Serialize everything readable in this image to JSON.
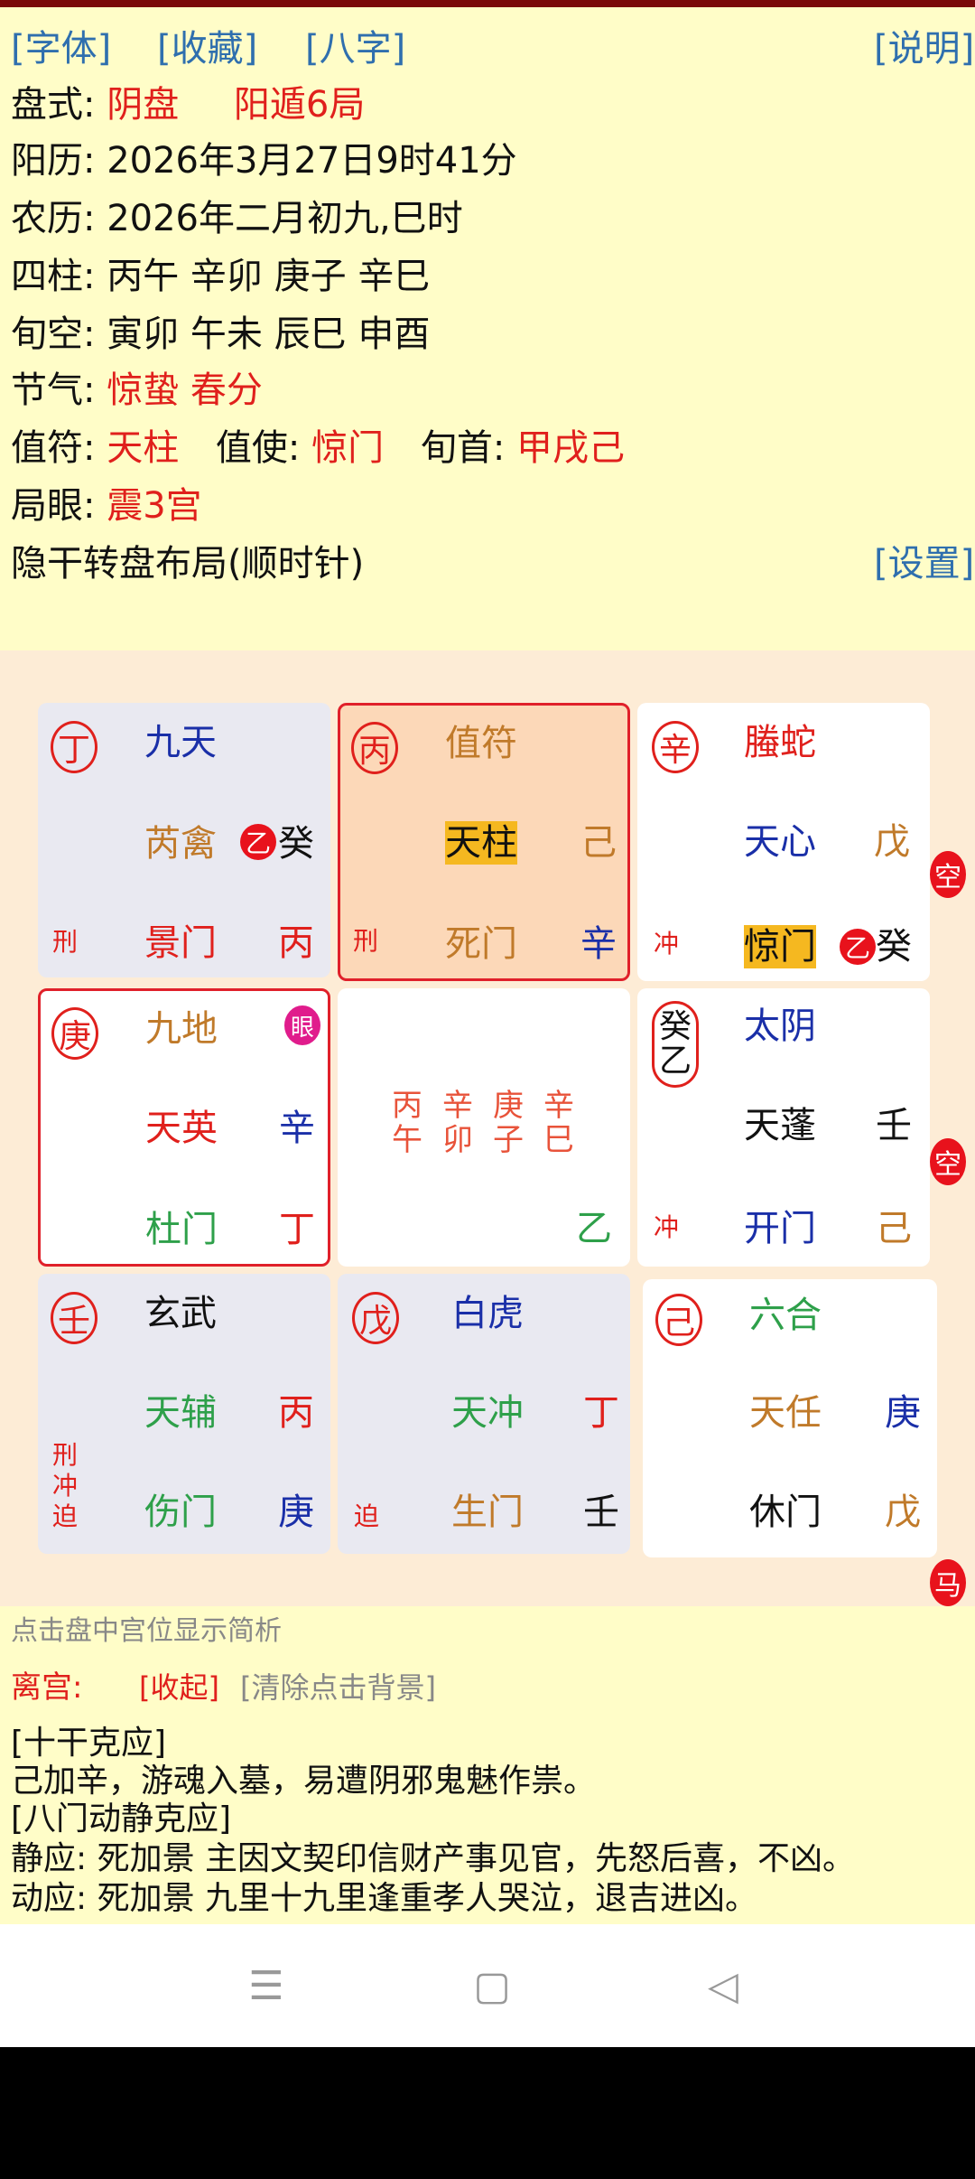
{
  "header": {
    "btn_font": "[字体]",
    "btn_fav": "[收藏]",
    "btn_bazi": "[八字]",
    "btn_help": "[说明]"
  },
  "info": {
    "panshi_label": "盘式:",
    "panshi_val1": "阴盘",
    "panshi_val2": "阳遁6局",
    "yangli": "阳历: 2026年3月27日9时41分",
    "nongli": "农历: 2026年二月初九,巳时",
    "sizhu": "四柱: 丙午  辛卯  庚子  辛巳",
    "xunkong": "旬空: 寅卯  午未  辰巳  申酉",
    "jieqi_label": "节气:",
    "jieqi_val": "惊蛰 春分",
    "zhifu_label": "值符:",
    "zhifu_val": "天柱",
    "zhishi_label": "值使:",
    "zhishi_val": "惊门",
    "xunshou_label": "旬首:",
    "xunshou_val": "甲戌己",
    "juyan_label": "局眼:",
    "juyan_val": "震3宫",
    "layout_text": "隐干转盘布局(顺时针)",
    "btn_settings": "[设置]"
  },
  "board": {
    "palaces": [
      {
        "id": "xun",
        "gan": "丁",
        "god": "九天",
        "star": "芮禽",
        "star_gan": "癸",
        "star_badge": "乙",
        "door": "景门",
        "door_gan": "丙",
        "tags": [
          "刑"
        ]
      },
      {
        "id": "li",
        "gan": "丙",
        "god": "值符",
        "star": "天柱",
        "star_gan": "己",
        "door": "死门",
        "door_gan": "辛",
        "tags": [
          "刑"
        ]
      },
      {
        "id": "kun",
        "gan": "辛",
        "god": "螣蛇",
        "star": "天心",
        "star_gan": "戊",
        "door": "惊门",
        "door_gan": "癸",
        "door_badge": "乙",
        "tags": [
          "冲"
        ]
      },
      {
        "id": "zhen",
        "gan": "庚",
        "god": "九地",
        "star": "天英",
        "star_gan": "辛",
        "door": "杜门",
        "door_gan": "丁",
        "eye": "眼"
      },
      {
        "id": "dui",
        "gan": "癸",
        "gan2": "乙",
        "god": "太阴",
        "star": "天蓬",
        "star_gan": "壬",
        "door": "开门",
        "door_gan": "己",
        "tags": [
          "冲"
        ]
      },
      {
        "id": "gen",
        "gan": "壬",
        "god": "玄武",
        "star": "天辅",
        "star_gan": "丙",
        "door": "伤门",
        "door_gan": "庚",
        "tags": [
          "刑",
          "冲",
          "迫"
        ]
      },
      {
        "id": "kan",
        "gan": "戊",
        "god": "白虎",
        "star": "天冲",
        "star_gan": "丁",
        "door": "生门",
        "door_gan": "壬",
        "tags": [
          "迫"
        ]
      },
      {
        "id": "qian",
        "gan": "己",
        "god": "六合",
        "star": "天任",
        "star_gan": "庚",
        "door": "休门",
        "door_gan": "戊"
      }
    ],
    "center": {
      "pillars": [
        [
          "丙",
          "午"
        ],
        [
          "辛",
          "卯"
        ],
        [
          "庚",
          "子"
        ],
        [
          "辛",
          "巳"
        ]
      ],
      "gan": "乙"
    },
    "side_kong1": "空",
    "side_kong2": "空",
    "side_ma": "马"
  },
  "bottom": {
    "hint": "点击盘中宫位显示简析",
    "palace_name": "离宫:",
    "btn_collapse": "[收起]",
    "btn_clear": "[清除点击背景]",
    "sec1_title": "[十干克应]",
    "sec1_text": "己加辛，游魂入墓，易遭阴邪鬼魅作祟。",
    "sec2_title": "[八门动静克应]",
    "sec2_line1": "静应: 死加景 主因文契印信财产事见官，先怒后喜，不凶。",
    "sec2_line2": "动应: 死加景 九里十九里逢重孝人哭泣，退吉进凶。"
  },
  "nav": {
    "menu_icon": "☰",
    "home_icon": "▢",
    "back_icon": "◁"
  },
  "colors": {
    "red": "#e0201c",
    "blue": "#2f6fae",
    "green": "#2ea04a",
    "brown": "#c07a2a",
    "navy": "#1a2fa8"
  }
}
